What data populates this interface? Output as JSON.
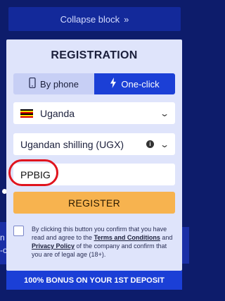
{
  "collapse": {
    "label": "Collapse block",
    "icon": "double-chevron-right-icon"
  },
  "side": {
    "letter": "n",
    "fragment": "-o"
  },
  "registration": {
    "title": "REGISTRATION",
    "tabs": [
      {
        "label": "By phone",
        "icon": "phone-icon",
        "active": false
      },
      {
        "label": "One-click",
        "icon": "lightning-icon",
        "active": true
      }
    ],
    "country": {
      "value": "Uganda",
      "flag_colors": [
        "#000000",
        "#fcdc04",
        "#d90000"
      ]
    },
    "currency": {
      "value": "Ugandan shilling (UGX)"
    },
    "promo": {
      "value": "PPBIG"
    },
    "register_label": "REGISTER",
    "consent": {
      "text_before": "By clicking this button you confirm that you have read and agree to the ",
      "terms_link": "Terms and Conditions",
      "text_middle": " and ",
      "privacy_link": "Privacy Policy",
      "text_after": " of the company and confirm that you are of legal age (18+)."
    }
  },
  "bonus_banner": "100% BONUS ON YOUR 1ST DEPOSIT",
  "colors": {
    "background": "#0d1c6b",
    "card": "#dfe4fb",
    "accent_blue": "#1b3fd6",
    "register": "#f7b34f",
    "highlight": "#e0141e"
  }
}
